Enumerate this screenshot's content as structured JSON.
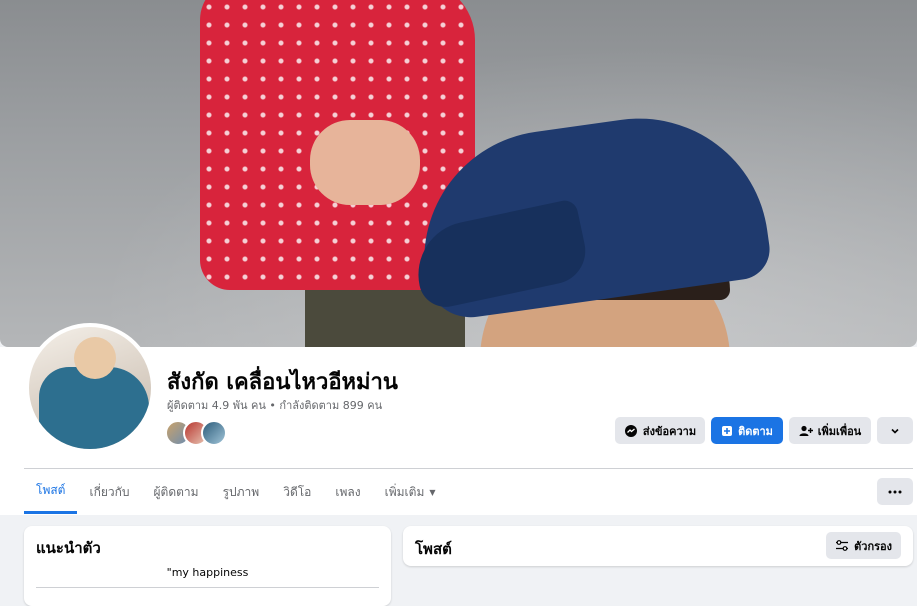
{
  "profile": {
    "name": "สังกัด เคลื่อนไหวอีหม่าน",
    "stats": "ผู้ติดตาม 4.9 พัน คน • กำลังติดตาม 899 คน"
  },
  "actions": {
    "message_label": "ส่งข้อความ",
    "follow_label": "ติดตาม",
    "add_friend_label": "เพิ่มเพื่อน"
  },
  "tabs": [
    {
      "label": "โพสต์"
    },
    {
      "label": "เกี่ยวกับ"
    },
    {
      "label": "ผู้ติดตาม"
    },
    {
      "label": "รูปภาพ"
    },
    {
      "label": "วิดีโอ"
    },
    {
      "label": "เพลง"
    },
    {
      "label": "เพิ่มเติม"
    }
  ],
  "intro": {
    "title": "แนะนำตัว",
    "bio": "\"my happiness"
  },
  "posts": {
    "title": "โพสต์",
    "filter_label": "ตัวกรอง"
  },
  "colors": {
    "accent": "#1b74e4",
    "button_grey": "#e4e6eb",
    "page_bg": "#f0f2f5"
  },
  "icons": {
    "message": "messenger-icon",
    "follow": "follow-icon",
    "add_friend": "add-friend-icon",
    "dropdown": "chevron-down-icon",
    "more": "more-dots-icon",
    "filter": "filter-icon"
  }
}
